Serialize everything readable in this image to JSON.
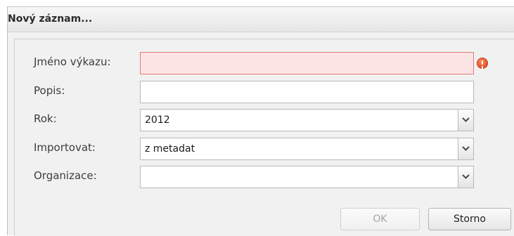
{
  "dialog": {
    "title": "Nový záznam..."
  },
  "form": {
    "fields": [
      {
        "label": "Jméno výkazu:",
        "value": "",
        "state": "invalid"
      },
      {
        "label": "Popis:",
        "value": ""
      },
      {
        "label": "Rok:",
        "value": "2012",
        "type": "combo"
      },
      {
        "label": "Importovat:",
        "value": "z metadat",
        "type": "combo"
      },
      {
        "label": "Organizace:",
        "value": "",
        "type": "combo"
      }
    ]
  },
  "buttons": {
    "ok_label": "OK",
    "ok_disabled": true,
    "cancel_label": "Storno"
  },
  "icons": {
    "error": "exclamation-error-icon",
    "trigger": "chevron-down-icon"
  },
  "colors": {
    "invalid_bg": "#fde4e4",
    "invalid_border": "#e37a7a",
    "error_icon": "#d8421a"
  }
}
